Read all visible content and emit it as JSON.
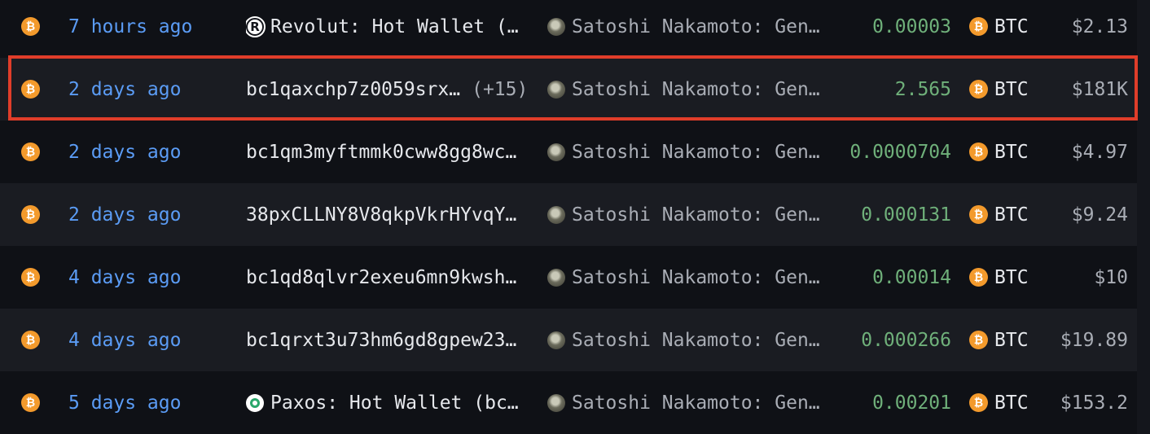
{
  "colors": {
    "accent_time": "#5b9cf5",
    "amount_green": "#6fb07a",
    "btc_orange": "#f39a2c",
    "highlight_red": "#e03d2a"
  },
  "rows": [
    {
      "chain_icon": "bitcoin-icon",
      "time": "7 hours ago",
      "from_icon": "revolut-icon",
      "from": "Revolut: Hot Wallet (…",
      "from_count": "",
      "to_icon": "satoshi-avatar-icon",
      "to": "Satoshi Nakamoto: Gen…",
      "amount": "0.00003",
      "token_icon": "bitcoin-icon",
      "token": "BTC",
      "usd": "$2.13"
    },
    {
      "chain_icon": "bitcoin-icon",
      "time": "2 days ago",
      "from_icon": "",
      "from": "bc1qaxchp7z0059srx…",
      "from_count": "(+15)",
      "to_icon": "satoshi-avatar-icon",
      "to": "Satoshi Nakamoto: Gen…",
      "amount": "2.565",
      "token_icon": "bitcoin-icon",
      "token": "BTC",
      "usd": "$181K"
    },
    {
      "chain_icon": "bitcoin-icon",
      "time": "2 days ago",
      "from_icon": "",
      "from": "bc1qm3myftmmk0cww8gg8wc…",
      "from_count": "",
      "to_icon": "satoshi-avatar-icon",
      "to": "Satoshi Nakamoto: Gen…",
      "amount": "0.0000704",
      "token_icon": "bitcoin-icon",
      "token": "BTC",
      "usd": "$4.97"
    },
    {
      "chain_icon": "bitcoin-icon",
      "time": "2 days ago",
      "from_icon": "",
      "from": "38pxCLLNY8V8qkpVkrHYvqY…",
      "from_count": "",
      "to_icon": "satoshi-avatar-icon",
      "to": "Satoshi Nakamoto: Gen…",
      "amount": "0.000131",
      "token_icon": "bitcoin-icon",
      "token": "BTC",
      "usd": "$9.24"
    },
    {
      "chain_icon": "bitcoin-icon",
      "time": "4 days ago",
      "from_icon": "",
      "from": "bc1qd8qlvr2exeu6mn9kwsh…",
      "from_count": "",
      "to_icon": "satoshi-avatar-icon",
      "to": "Satoshi Nakamoto: Gen…",
      "amount": "0.00014",
      "token_icon": "bitcoin-icon",
      "token": "BTC",
      "usd": "$10"
    },
    {
      "chain_icon": "bitcoin-icon",
      "time": "4 days ago",
      "from_icon": "",
      "from": "bc1qrxt3u73hm6gd8gpew23…",
      "from_count": "",
      "to_icon": "satoshi-avatar-icon",
      "to": "Satoshi Nakamoto: Gen…",
      "amount": "0.000266",
      "token_icon": "bitcoin-icon",
      "token": "BTC",
      "usd": "$19.89"
    },
    {
      "chain_icon": "bitcoin-icon",
      "time": "5 days ago",
      "from_icon": "paxos-icon",
      "from": "Paxos: Hot Wallet (bc…",
      "from_count": "",
      "to_icon": "satoshi-avatar-icon",
      "to": "Satoshi Nakamoto: Gen…",
      "amount": "0.00201",
      "token_icon": "bitcoin-icon",
      "token": "BTC",
      "usd": "$153.2"
    }
  ],
  "highlighted_row": 1
}
